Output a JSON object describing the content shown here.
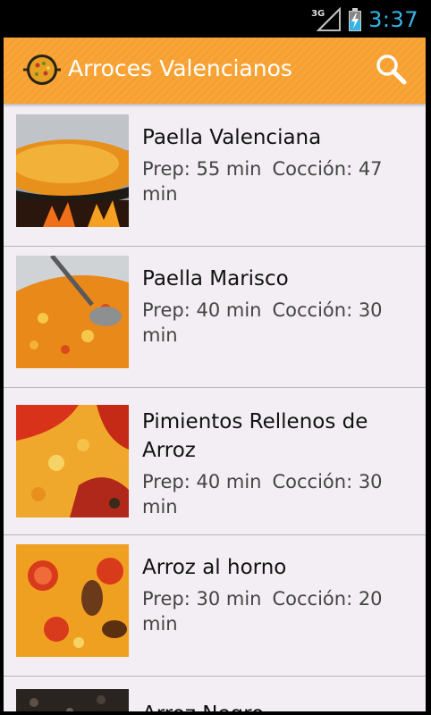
{
  "status_bar": {
    "network_type": "3G",
    "time": "3:37",
    "clock_color": "#33b5e5"
  },
  "action_bar": {
    "title": "Arroces Valencianos",
    "background_color": "#f9a53a",
    "app_icon": "paella-pan-icon",
    "action_icon": "search-icon"
  },
  "recipes": [
    {
      "title": "Paella Valenciana",
      "prep": "Prep: 55 min",
      "coccion": "Cocción: 47 min"
    },
    {
      "title": "Paella Marisco",
      "prep": "Prep: 40 min",
      "coccion": "Cocción: 30 min"
    },
    {
      "title": "Pimientos Rellenos de Arroz",
      "prep": "Prep: 40 min",
      "coccion": "Cocción: 30 min"
    },
    {
      "title": "Arroz al horno",
      "prep": "Prep: 30 min",
      "coccion": "Cocción: 20 min"
    },
    {
      "title": "Arroz Negro",
      "prep": "",
      "coccion": ""
    }
  ]
}
